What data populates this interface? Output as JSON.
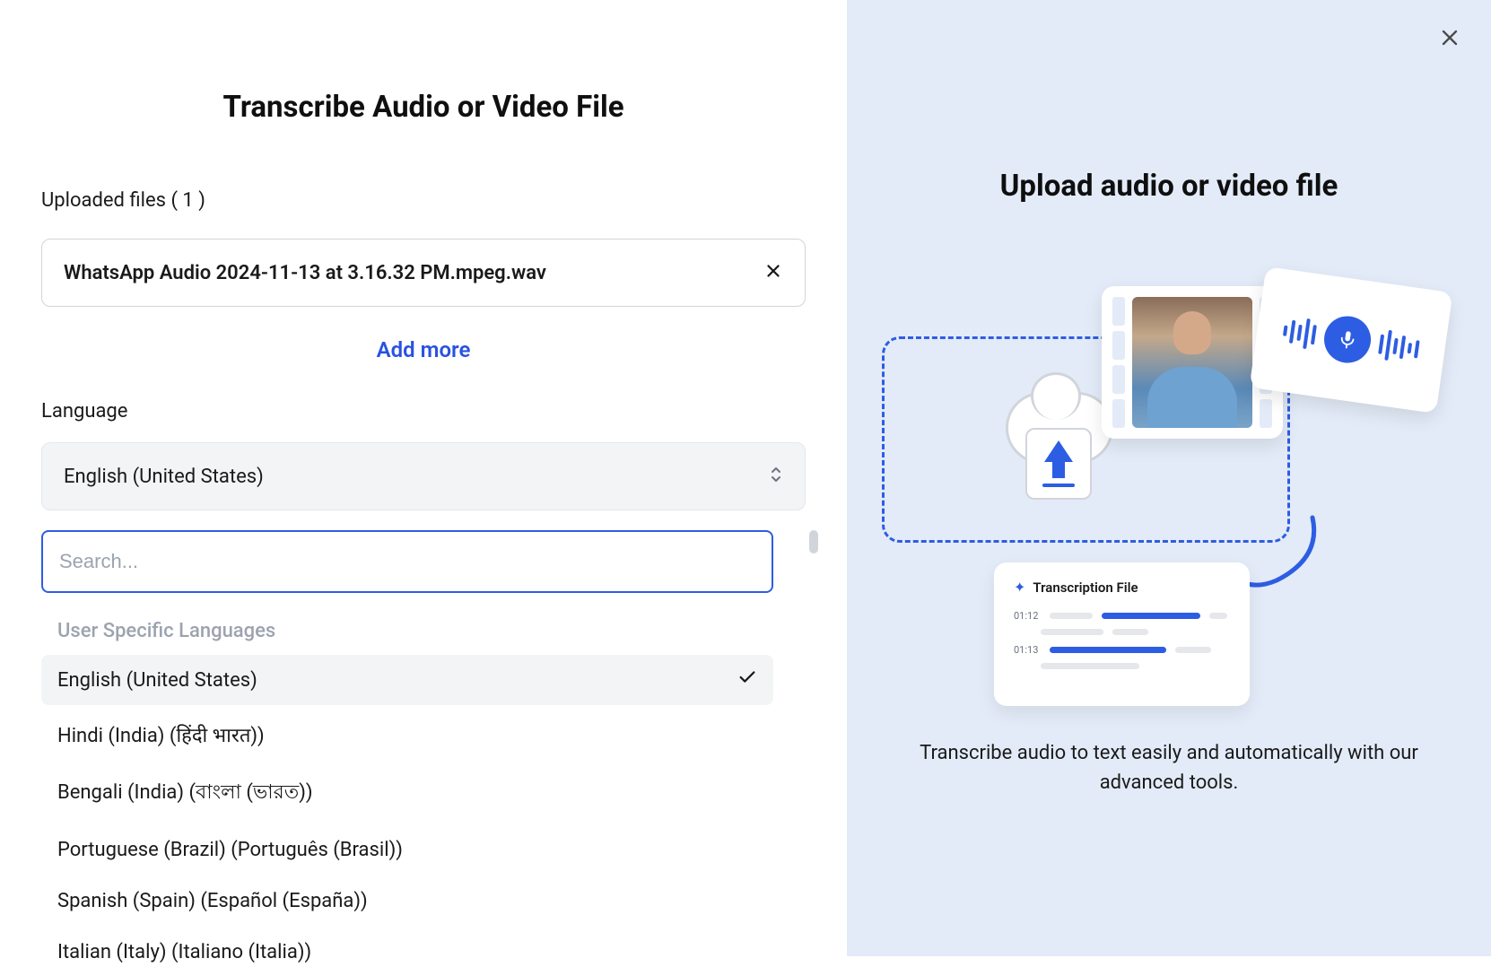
{
  "left": {
    "title": "Transcribe Audio or Video File",
    "uploadedLabel": "Uploaded files ( 1 )",
    "file": {
      "name": "WhatsApp Audio 2024-11-13 at 3.16.32 PM.mpeg.wav"
    },
    "addMore": "Add more",
    "languageLabel": "Language",
    "selectedLanguage": "English (United States)",
    "searchPlaceholder": "Search...",
    "dropdownSectionTitle": "User Specific Languages",
    "languages": [
      {
        "label": "English (United States)",
        "selected": true
      },
      {
        "label": "Hindi (India) (हिंदी भारत))",
        "selected": false
      },
      {
        "label": "Bengali (India) (বাংলা (ভারত))",
        "selected": false
      },
      {
        "label": "Portuguese (Brazil) (Português (Brasil))",
        "selected": false
      },
      {
        "label": "Spanish (Spain) (Español (España))",
        "selected": false
      },
      {
        "label": "Italian (Italy) (Italiano (Italia))",
        "selected": false
      }
    ]
  },
  "right": {
    "title": "Upload audio or video file",
    "transcriptCardTitle": "Transcription File",
    "timestamp1": "01:12",
    "timestamp2": "01:13",
    "description": "Transcribe audio to text easily and automatically with our advanced tools."
  }
}
